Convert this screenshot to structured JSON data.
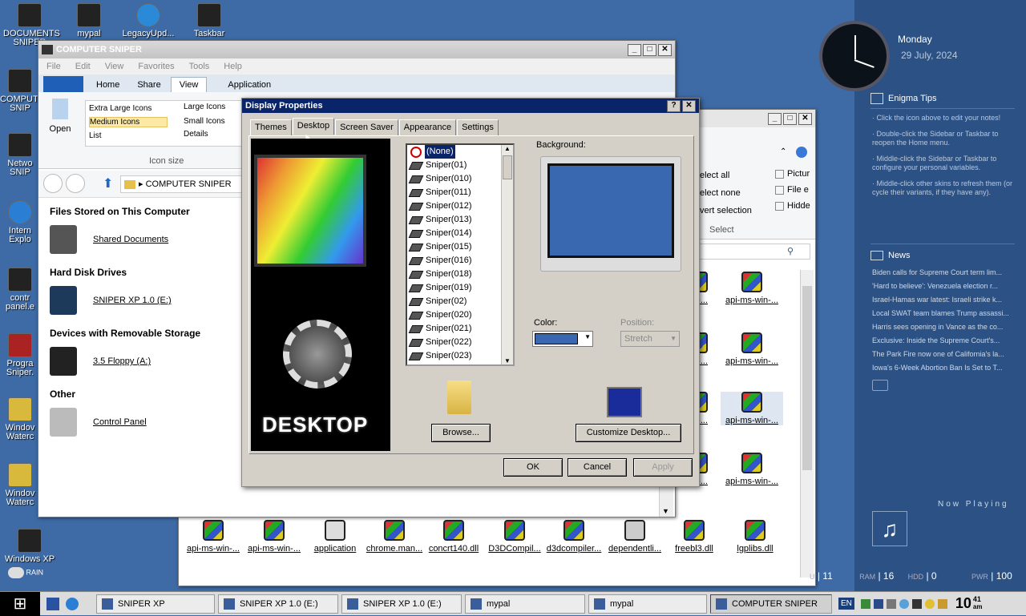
{
  "desktop_icons": [
    {
      "label": "DOCUMENTS\nSNIPER"
    },
    {
      "label": "mypal"
    },
    {
      "label": "LegacyUpd..."
    },
    {
      "label": "Taskbar"
    },
    {
      "label": "COMPUTER\nSNIP"
    },
    {
      "label": "Netwo\nSNIP"
    },
    {
      "label": "Intern\nExplo"
    },
    {
      "label": "contr\npanel.e"
    },
    {
      "label": "Progra\nSniper."
    },
    {
      "label": "Windov\nWaterc"
    },
    {
      "label": "Windov\nWaterc"
    },
    {
      "label": "Windows XP"
    }
  ],
  "weather": {
    "label": "RAIN"
  },
  "explorer": {
    "title": "COMPUTER SNIPER",
    "menu": [
      "File",
      "Edit",
      "View",
      "Favorites",
      "Tools",
      "Help"
    ],
    "tabs": [
      "Home",
      "Share",
      "View",
      "Application"
    ],
    "ribbon": {
      "open": "Open",
      "layouts": [
        "Extra Large Icons",
        "Large Icons",
        "Medium Icons",
        "Small Icons",
        "List",
        "Details"
      ],
      "group_label": "Icon size"
    },
    "address": "COMPUTER SNIPER",
    "sections": [
      {
        "title": "Files Stored on This Computer",
        "items": [
          "Shared Documents"
        ]
      },
      {
        "title": "Hard Disk Drives",
        "items": [
          "SNIPER XP 1.0 (E:)"
        ]
      },
      {
        "title": "Devices with Removable Storage",
        "items": [
          "3.5 Floppy (A:)"
        ]
      },
      {
        "title": "Other",
        "items": [
          "Control Panel"
        ]
      }
    ]
  },
  "back_window": {
    "ribbon_items": [
      "elect all",
      "elect none",
      "vert selection"
    ],
    "ribbon_group": "Select",
    "checks": [
      "Pictur",
      "File e",
      "Hidde"
    ],
    "files_right": [
      "api-ms-win-...",
      "api-ms-win-...",
      "api-ms-win-...",
      "api-ms-win-..."
    ],
    "files_bottom": [
      "api-ms-win-...",
      "api-ms-win-...",
      "application",
      "chrome.man...",
      "concrt140.dll",
      "D3DCompil...",
      "d3dcompiler...",
      "dependentli...",
      "freebl3.dll",
      "lgplibs.dll"
    ],
    "partial_labels": [
      "win-...",
      "win-...",
      "win-...",
      "win-..."
    ]
  },
  "dialog": {
    "title": "Display Properties",
    "tabs": [
      "Themes",
      "Desktop",
      "Screen Saver",
      "Appearance",
      "Settings"
    ],
    "background_label": "Background:",
    "backgrounds": [
      "(None)",
      "Sniper(01)",
      "Sniper(010)",
      "Sniper(011)",
      "Sniper(012)",
      "Sniper(013)",
      "Sniper(014)",
      "Sniper(015)",
      "Sniper(016)",
      "Sniper(018)",
      "Sniper(019)",
      "Sniper(02)",
      "Sniper(020)",
      "Sniper(021)",
      "Sniper(022)",
      "Sniper(023)"
    ],
    "preview_text": "DESKTOP",
    "color_label": "Color:",
    "color_value": "#3a68b0",
    "position_label": "Position:",
    "position_value": "Stretch",
    "browse": "Browse...",
    "customize": "Customize Desktop...",
    "ok": "OK",
    "cancel": "Cancel",
    "apply": "Apply"
  },
  "sidebar": {
    "day": "Monday",
    "date": "29 July, 2024",
    "tips_title": "Enigma Tips",
    "tips": [
      "· Click the icon above to edit your notes!",
      "· Double-click the Sidebar or Taskbar to reopen the Home menu.",
      "· Middle-click the Sidebar or Taskbar to configure your personal variables.",
      "· Middle-click other skins to refresh them (or cycle their variants, if they have any)."
    ],
    "news_title": "News",
    "news": [
      "Biden calls for Supreme Court term lim...",
      "'Hard to believe': Venezuela election r...",
      "Israel-Hamas war latest: Israeli strike k...",
      "Local SWAT team blames Trump assassi...",
      "Harris sees opening in Vance as the co...",
      "Exclusive: Inside the Supreme Court's...",
      "The Park Fire now one of California's la...",
      "Iowa's 6-Week Abortion Ban Is Set to T..."
    ],
    "now_playing": "Now Playing",
    "stats": {
      "cpu_tail": "U",
      "cpu": "11",
      "ram_label": "RAM",
      "ram": "16",
      "hdd_label": "HDD",
      "hdd": "0",
      "pwr_label": "PWR",
      "pwr": "100"
    }
  },
  "taskbar": {
    "items": [
      "SNIPER XP",
      "SNIPER XP 1.0 (E:)",
      "SNIPER XP 1.0 (E:)",
      "mypal",
      "mypal",
      "COMPUTER SNIPER"
    ],
    "lang": "EN",
    "clock_hour": "10",
    "clock_min": "41",
    "clock_ampm": "am"
  }
}
